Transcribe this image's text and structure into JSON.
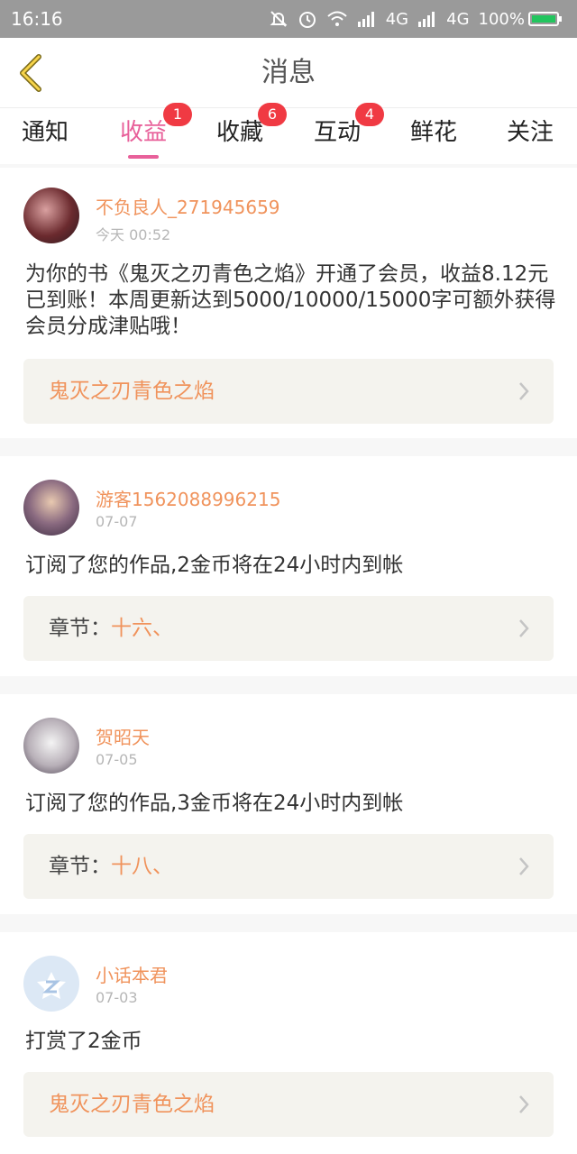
{
  "status_bar": {
    "time": "16:16",
    "net1": "4G",
    "net2": "4G",
    "battery": "100%"
  },
  "header": {
    "title": "消息",
    "back_icon": "chevron-left-icon",
    "accent": "#e8609a"
  },
  "tabs": [
    {
      "label": "通知",
      "badge": ""
    },
    {
      "label": "收益",
      "badge": "1",
      "active": true
    },
    {
      "label": "收藏",
      "badge": "6"
    },
    {
      "label": "互动",
      "badge": "4"
    },
    {
      "label": "鲜花",
      "badge": ""
    },
    {
      "label": "关注",
      "badge": ""
    }
  ],
  "messages": [
    {
      "user": "不负良人_271945659",
      "time": "今天 00:52",
      "text": "为你的书《鬼灭之刃青色之焰》开通了会员，收益8.12元已到账！本周更新达到5000/10000/15000字可额外获得会员分成津贴哦！",
      "ref_prefix": "",
      "ref": "鬼灭之刃青色之焰"
    },
    {
      "user": "游客1562088996215",
      "time": "07-07",
      "text": "订阅了您的作品,2金币将在24小时内到帐",
      "ref_prefix": "章节：",
      "ref": "十六、"
    },
    {
      "user": "贺昭天",
      "time": "07-05",
      "text": "订阅了您的作品,3金币将在24小时内到帐",
      "ref_prefix": "章节：",
      "ref": "十八、"
    },
    {
      "user": "小话本君",
      "time": "07-03",
      "text": "打赏了2金币",
      "ref_prefix": "",
      "ref": "鬼灭之刃青色之焰"
    }
  ],
  "colors": {
    "username": "#f0935c",
    "badge": "#f03a43",
    "ref_bg": "#f4f3ee"
  }
}
